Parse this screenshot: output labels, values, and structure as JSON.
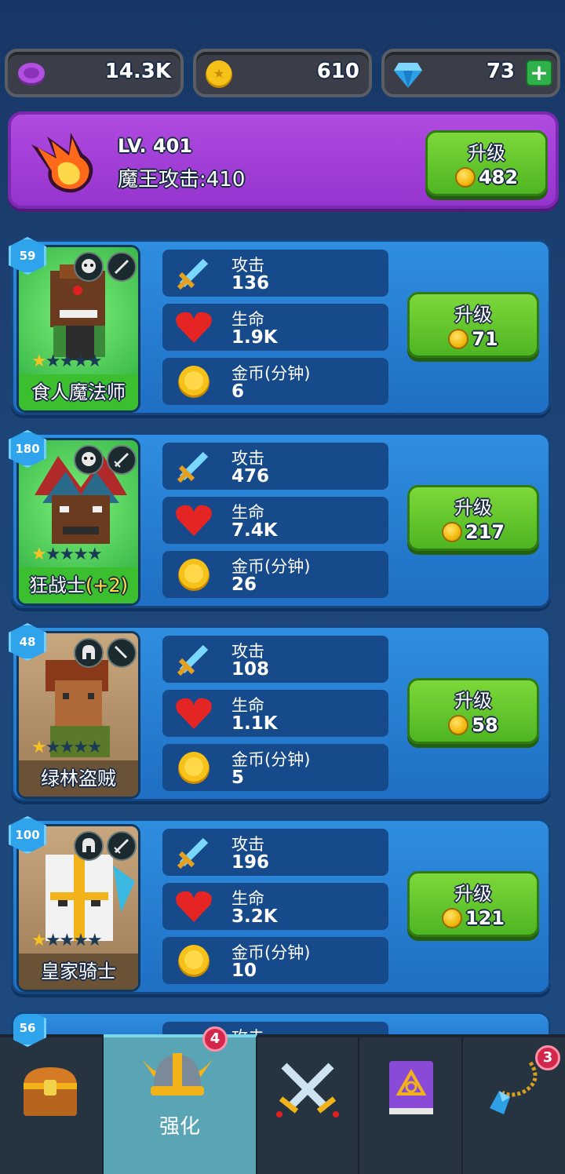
{
  "currency": {
    "gems_purple": "14.3K",
    "gold": "610",
    "diamond": "73"
  },
  "boss": {
    "level": "LV. 401",
    "attack": "魔王攻击:410",
    "upgrade_label": "升级",
    "upgrade_cost": "482"
  },
  "heroes": [
    {
      "level": "59",
      "name": "食人魔法师",
      "stars": 1,
      "attack_label": "攻击",
      "attack": "136",
      "hp_label": "生命",
      "hp": "1.9K",
      "gold_label": "金币(分钟)",
      "gold": "6",
      "upgrade_label": "升级",
      "upgrade_cost": "71"
    },
    {
      "level": "180",
      "name": "狂战士",
      "bonus": "(+2)",
      "stars": 1,
      "attack_label": "攻击",
      "attack": "476",
      "hp_label": "生命",
      "hp": "7.4K",
      "gold_label": "金币(分钟)",
      "gold": "26",
      "upgrade_label": "升级",
      "upgrade_cost": "217"
    },
    {
      "level": "48",
      "name": "绿林盗贼",
      "stars": 1,
      "attack_label": "攻击",
      "attack": "108",
      "hp_label": "生命",
      "hp": "1.1K",
      "gold_label": "金币(分钟)",
      "gold": "5",
      "upgrade_label": "升级",
      "upgrade_cost": "58"
    },
    {
      "level": "100",
      "name": "皇家骑士",
      "stars": 1,
      "attack_label": "攻击",
      "attack": "196",
      "hp_label": "生命",
      "hp": "3.2K",
      "gold_label": "金币(分钟)",
      "gold": "10",
      "upgrade_label": "升级",
      "upgrade_cost": "121"
    },
    {
      "level": "56",
      "attack_label": "攻击"
    }
  ],
  "nav": {
    "tabs": [
      {
        "icon": "treasure-chest-icon"
      },
      {
        "icon": "viking-helmet-icon",
        "label": "强化",
        "badge": "4"
      },
      {
        "icon": "crossed-swords-icon"
      },
      {
        "icon": "spellbook-icon"
      },
      {
        "icon": "amulet-icon",
        "badge": "3"
      }
    ]
  },
  "colors": {
    "background": "#1d4577",
    "boss_panel": "#9c38d4",
    "card": "#2a82d6",
    "button_green": "#5fc42b",
    "nav_active": "#5aa5b5"
  }
}
